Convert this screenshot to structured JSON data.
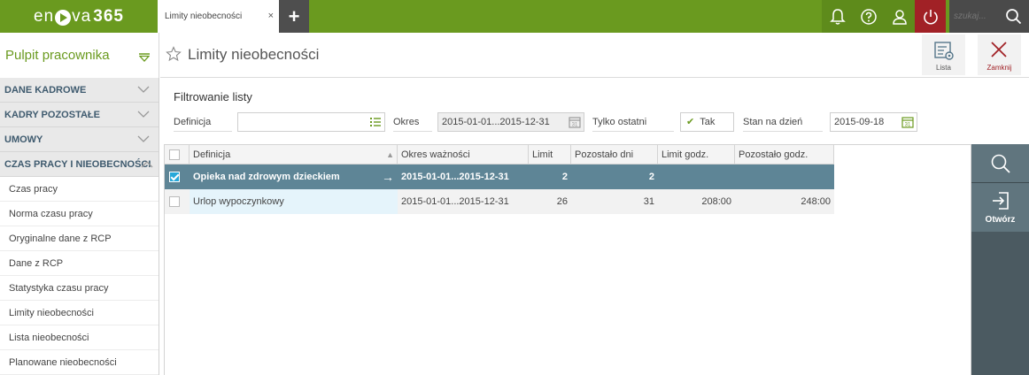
{
  "app": {
    "logo_text_a": "en",
    "logo_text_b": "va",
    "logo_num": "365",
    "tab_label": "Limity nieobecności",
    "tab_close": "×",
    "add_tab": "+",
    "search_placeholder": "szukaj..."
  },
  "left_header": {
    "title": "Pulpit pracownika"
  },
  "sidebar": {
    "sections": [
      {
        "label": "DANE KADROWE"
      },
      {
        "label": "KADRY POZOSTAŁE"
      },
      {
        "label": "UMOWY"
      },
      {
        "label": "CZAS PRACY I NIEOBECNOŚCI"
      }
    ],
    "items": [
      {
        "label": "Czas pracy"
      },
      {
        "label": "Norma czasu pracy"
      },
      {
        "label": "Oryginalne dane z RCP"
      },
      {
        "label": "Dane z RCP"
      },
      {
        "label": "Statystyka czasu pracy"
      },
      {
        "label": "Limity nieobecności"
      },
      {
        "label": "Lista nieobecności"
      },
      {
        "label": "Planowane nieobecności"
      }
    ]
  },
  "page": {
    "title": "Limity nieobecności",
    "lista_label": "Lista",
    "zamknij_label": "Zamknij"
  },
  "filter": {
    "title": "Filtrowanie listy",
    "definicja_label": "Definicja",
    "definicja_value": "",
    "okres_label": "Okres",
    "okres_value": "2015-01-01...2015-12-31",
    "tylko_label": "Tylko ostatni",
    "tylko_value": "Tak",
    "stan_label": "Stan na dzień",
    "stan_value": "2015-09-18"
  },
  "grid": {
    "headers": [
      "Definicja",
      "Okres ważności",
      "Limit",
      "Pozostało dni",
      "Limit godz.",
      "Pozostało godz."
    ],
    "rows": [
      {
        "selected": true,
        "definicja": "Opieka nad zdrowym dzieckiem",
        "okres": "2015-01-01...2015-12-31",
        "limit": "2",
        "pozostalo_dni": "2",
        "limit_godz": "",
        "pozostalo_godz": ""
      },
      {
        "selected": false,
        "definicja": "Urlop wypoczynkowy",
        "okres": "2015-01-01...2015-12-31",
        "limit": "26",
        "pozostalo_dni": "31",
        "limit_godz": "208:00",
        "pozostalo_godz": "248:00"
      }
    ]
  },
  "actions": {
    "open_label": "Otwórz"
  },
  "colors": {
    "brand_green": "#6a9a1f",
    "selected_row": "#5e8596",
    "panel": "#4b5a61",
    "close_red": "#a12126"
  }
}
